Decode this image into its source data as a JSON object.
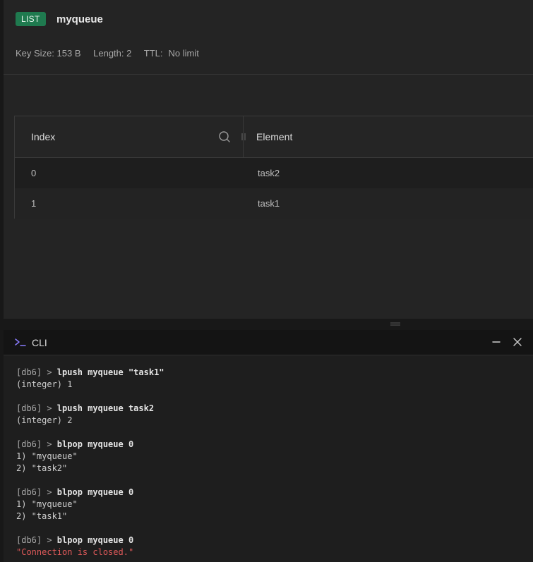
{
  "key": {
    "type_badge": "LIST",
    "name": "myqueue",
    "meta": {
      "key_size": "Key Size: 153 B",
      "length": "Length: 2",
      "ttl_label": "TTL:",
      "ttl_value": "No limit"
    }
  },
  "table": {
    "columns": [
      "Index",
      "Element"
    ],
    "rows": [
      {
        "index": "0",
        "element": "task2"
      },
      {
        "index": "1",
        "element": "task1"
      }
    ]
  },
  "cli": {
    "title": "CLI",
    "prompt": "[db6] > ",
    "blocks": [
      {
        "command": "lpush myqueue \"task1\"",
        "output": [
          "(integer) 1"
        ]
      },
      {
        "command": "lpush myqueue task2",
        "output": [
          "(integer) 2"
        ]
      },
      {
        "command": "blpop myqueue 0",
        "output": [
          "1) \"myqueue\"",
          "2) \"task2\""
        ]
      },
      {
        "command": "blpop myqueue 0",
        "output": [
          "1) \"myqueue\"",
          "2) \"task1\""
        ]
      },
      {
        "command": "blpop myqueue 0",
        "error": "\"Connection is closed.\""
      }
    ]
  },
  "colors": {
    "badge_bg": "#1f7a4f",
    "cli_icon": "#8a7cff",
    "error_text": "#e05a5a"
  },
  "icons": {
    "cli": "terminal-prompt-icon",
    "search": "search-icon",
    "minimize": "minimize-icon",
    "close": "close-icon"
  }
}
